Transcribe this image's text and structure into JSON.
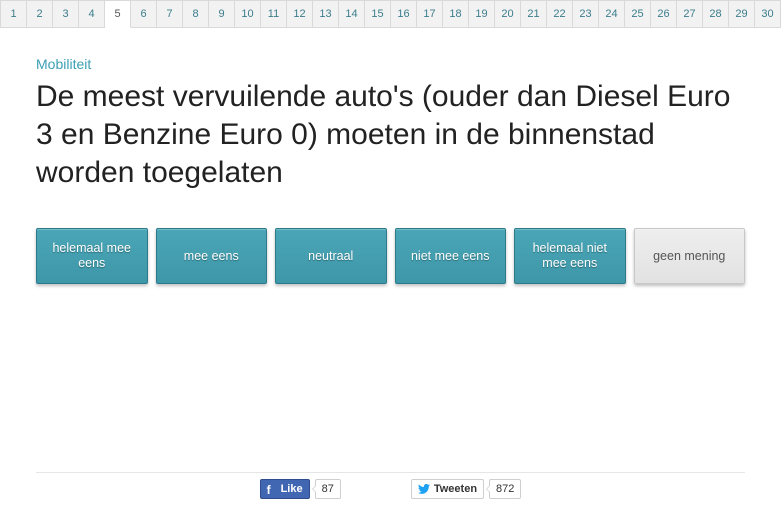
{
  "pager": {
    "current": 5,
    "pages": [
      1,
      2,
      3,
      4,
      5,
      6,
      7,
      8,
      9,
      10,
      11,
      12,
      13,
      14,
      15,
      16,
      17,
      18,
      19,
      20,
      21,
      22,
      23,
      24,
      25,
      26,
      27,
      28,
      29,
      30
    ]
  },
  "category": "Mobiliteit",
  "question": "De meest vervuilende auto's (ouder dan Diesel Euro 3 en Benzine Euro 0) moeten in de binnenstad worden toegelaten",
  "answers": [
    {
      "id": "strong-agree",
      "label": "helemaal mee eens",
      "kind": "primary"
    },
    {
      "id": "agree",
      "label": "mee eens",
      "kind": "primary"
    },
    {
      "id": "neutral",
      "label": "neutraal",
      "kind": "primary"
    },
    {
      "id": "disagree",
      "label": "niet mee eens",
      "kind": "primary"
    },
    {
      "id": "strong-disagree",
      "label": "helemaal niet mee eens",
      "kind": "primary"
    },
    {
      "id": "no-opinion",
      "label": "geen mening",
      "kind": "neutral"
    }
  ],
  "share": {
    "facebook": {
      "label": "Like",
      "count": "87"
    },
    "twitter": {
      "label": "Tweeten",
      "count": "872"
    }
  }
}
